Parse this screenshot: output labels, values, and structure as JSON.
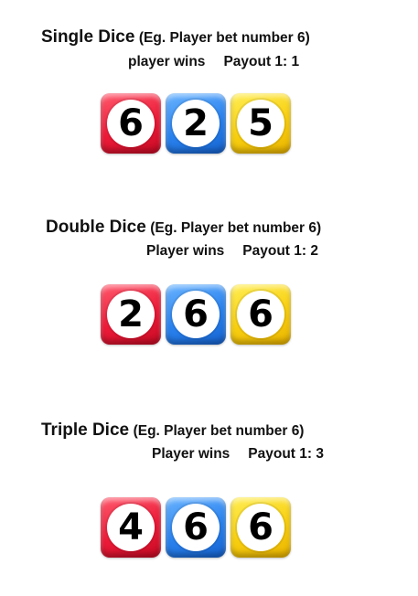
{
  "sections": [
    {
      "title": "Single  Dice",
      "example": "(Eg. Player bet number 6)",
      "result": "player wins",
      "payout": "Payout 1: 1",
      "dice": [
        {
          "value": "6",
          "color": "red"
        },
        {
          "value": "2",
          "color": "blue"
        },
        {
          "value": "5",
          "color": "yellow"
        }
      ]
    },
    {
      "title": "Double Dice",
      "example": "(Eg. Player bet number 6)",
      "result": "Player wins",
      "payout": "Payout 1: 2",
      "dice": [
        {
          "value": "2",
          "color": "red"
        },
        {
          "value": "6",
          "color": "blue"
        },
        {
          "value": "6",
          "color": "yellow"
        }
      ]
    },
    {
      "title": "Triple Dice",
      "example": "(Eg. Player bet number 6)",
      "result": "Player wins",
      "payout": "Payout 1: 3",
      "dice": [
        {
          "value": "4",
          "color": "red"
        },
        {
          "value": "6",
          "color": "blue"
        },
        {
          "value": "6",
          "color": "yellow"
        }
      ]
    }
  ],
  "colors": {
    "red": "#ec1b38",
    "blue": "#2a82ee",
    "yellow": "#f8cf10"
  }
}
